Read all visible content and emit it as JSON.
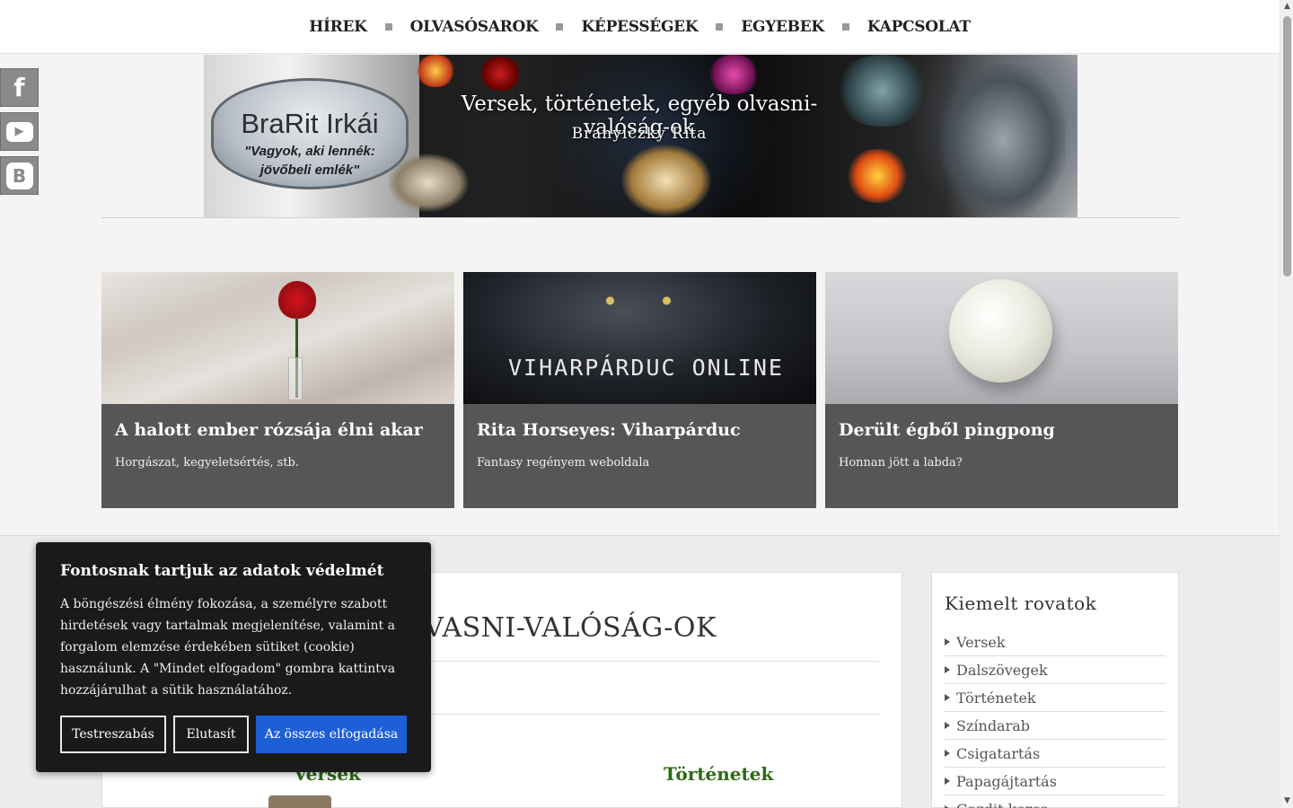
{
  "nav": {
    "items": [
      "HÍREK",
      "OLVASÓSAROK",
      "KÉPESSÉGEK",
      "EGYEBEK",
      "KAPCSOLAT"
    ]
  },
  "social": {
    "facebook_glyph": "f",
    "youtube_glyph": "▶",
    "blogger_glyph": "B"
  },
  "banner": {
    "plate_title": "BraRit Irkái",
    "plate_quote_line1": "\"Vagyok, aki lennék:",
    "plate_quote_line2": "jövőbeli emlék\"",
    "site_title": "Versek, történetek, egyéb olvasni-valóság-ok",
    "site_author": "Branyiczky Rita"
  },
  "featured": [
    {
      "title": "A halott ember rózsája élni akar",
      "excerpt": "Horgászat, kegyeletsértés, stb."
    },
    {
      "title": "Rita Horseyes: Viharpárduc",
      "excerpt": "Fantasy regényem weboldala",
      "image_text": "VIHARPÁRDUC ONLINE"
    },
    {
      "title": "Derült égből pingpong",
      "excerpt": "Honnan jött a labda?"
    }
  ],
  "main": {
    "heading": "ETEK, OLVASNI-VALÓSÁG-OK",
    "col1_title": "Versek",
    "col2_title": "Történetek"
  },
  "sidebar": {
    "title": "Kiemelt rovatok",
    "items": [
      "Versek",
      "Dalszövegek",
      "Történetek",
      "Színdarab",
      "Csigatartás",
      "Papagájtartás",
      "Gazdit keres"
    ]
  },
  "cookie": {
    "title": "Fontosnak tartjuk az adatok védelmét",
    "text": "A böngészési élmény fokozása, a személyre szabott hirdetések vagy tartalmak megjelenítése, valamint a forgalom elemzése érdekében sütiket (cookie) használunk. A \"Mindet elfogadom\" gombra kattintva hozzájárulhat a sütik használatához.",
    "customize": "Testreszabás",
    "reject": "Elutasít",
    "accept_all": "Az összes elfogadása"
  },
  "colors": {
    "nav_bg": "#ffffff",
    "card_bg": "#565656",
    "accent_green": "#2e6a16",
    "cookie_bg": "#1a1a1a",
    "accept_blue": "#1e5fd6"
  }
}
